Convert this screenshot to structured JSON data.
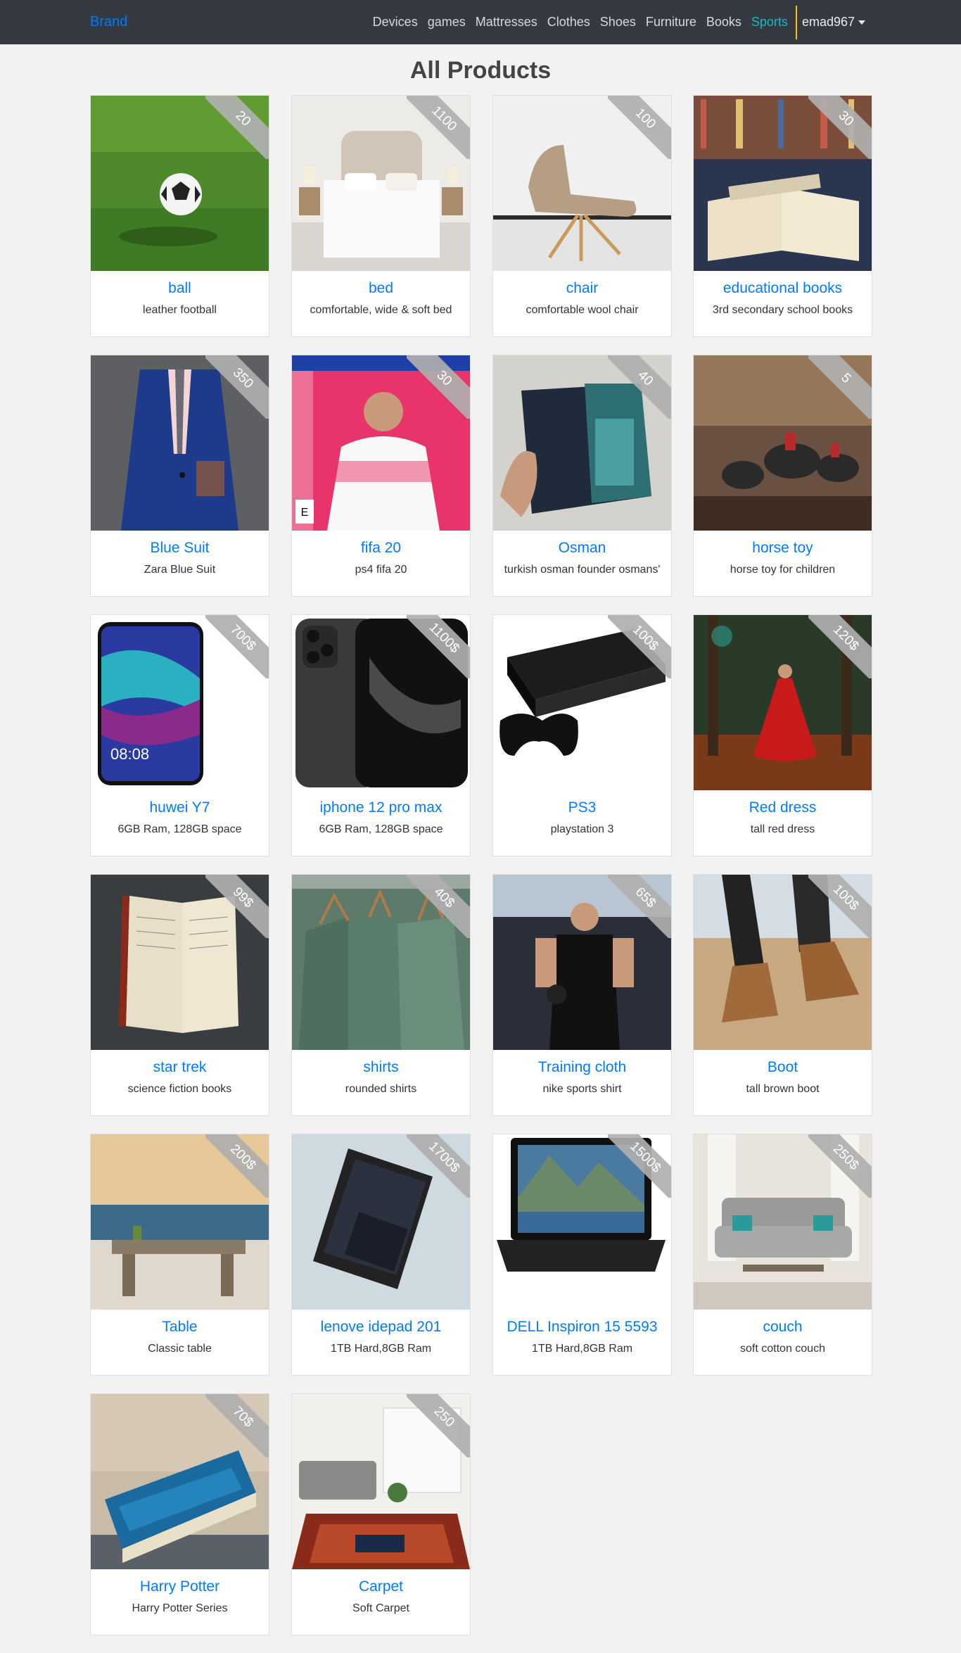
{
  "navbar": {
    "brand": "Brand",
    "links": [
      "Devices",
      "games",
      "Mattresses",
      "Clothes",
      "Shoes",
      "Furniture",
      "Books",
      "Sports"
    ],
    "active_link": "Sports",
    "user": "emad967"
  },
  "page": {
    "title": "All Products"
  },
  "products": [
    {
      "name": "ball",
      "desc": "leather football",
      "price": "20",
      "image": "football-on-grass"
    },
    {
      "name": "bed",
      "desc": "comfortable, wide & soft bed",
      "price": "1100",
      "image": "white-bed"
    },
    {
      "name": "chair",
      "desc": "comfortable wool chair",
      "price": "100",
      "image": "lounge-chair"
    },
    {
      "name": "educational books",
      "desc": "3rd secondary school books",
      "price": "30",
      "image": "open-book"
    },
    {
      "name": "Blue Suit",
      "desc": "Zara Blue Suit",
      "price": "350",
      "image": "blue-suit"
    },
    {
      "name": "fifa 20",
      "desc": "ps4 fifa 20",
      "price": "30",
      "image": "fifa-cover"
    },
    {
      "name": "Osman",
      "desc": "turkish osman founder osmans'",
      "price": "40",
      "image": "history-book"
    },
    {
      "name": "horse toy",
      "desc": "horse toy for children",
      "price": "5",
      "image": "horse-figurines"
    },
    {
      "name": "huwei Y7",
      "desc": "6GB Ram, 128GB space",
      "price": "700$",
      "image": "huawei-phone"
    },
    {
      "name": "iphone 12 pro max",
      "desc": "6GB Ram, 128GB space",
      "price": "1100$",
      "image": "iphone"
    },
    {
      "name": "PS3",
      "desc": "playstation 3",
      "price": "100$",
      "image": "ps3-console"
    },
    {
      "name": "Red dress",
      "desc": "tall red dress",
      "price": "120$",
      "image": "red-dress"
    },
    {
      "name": "star trek",
      "desc": "science fiction books",
      "price": "99$",
      "image": "old-book"
    },
    {
      "name": "shirts",
      "desc": "rounded shirts",
      "price": "40$",
      "image": "shirts-hanging"
    },
    {
      "name": "Training cloth",
      "desc": "nike sports shirt",
      "price": "65$",
      "image": "gym-man"
    },
    {
      "name": "Boot",
      "desc": "tall brown boot",
      "price": "100$",
      "image": "brown-boot"
    },
    {
      "name": "Table",
      "desc": "Classic table",
      "price": "200$",
      "image": "wooden-table"
    },
    {
      "name": "lenove idepad 201",
      "desc": "1TB Hard,8GB Ram",
      "price": "1700$",
      "image": "lenovo-laptop"
    },
    {
      "name": "DELL Inspiron 15 5593",
      "desc": "1TB Hard,8GB Ram",
      "price": "1500$",
      "image": "dell-laptop"
    },
    {
      "name": "couch",
      "desc": "soft cotton couch",
      "price": "250$",
      "image": "grey-couch"
    },
    {
      "name": "Harry Potter",
      "desc": "Harry Potter Series",
      "price": "70$",
      "image": "harry-potter-book"
    },
    {
      "name": "Carpet",
      "desc": "Soft Carpet",
      "price": "250",
      "image": "living-room-carpet"
    }
  ],
  "colors": {
    "navbar_bg": "#343a40",
    "brand": "#007bff",
    "active_link": "#17b8c7",
    "divider": "#ffc107",
    "title_link": "#007bff",
    "page_bg": "#f2f2f2"
  }
}
